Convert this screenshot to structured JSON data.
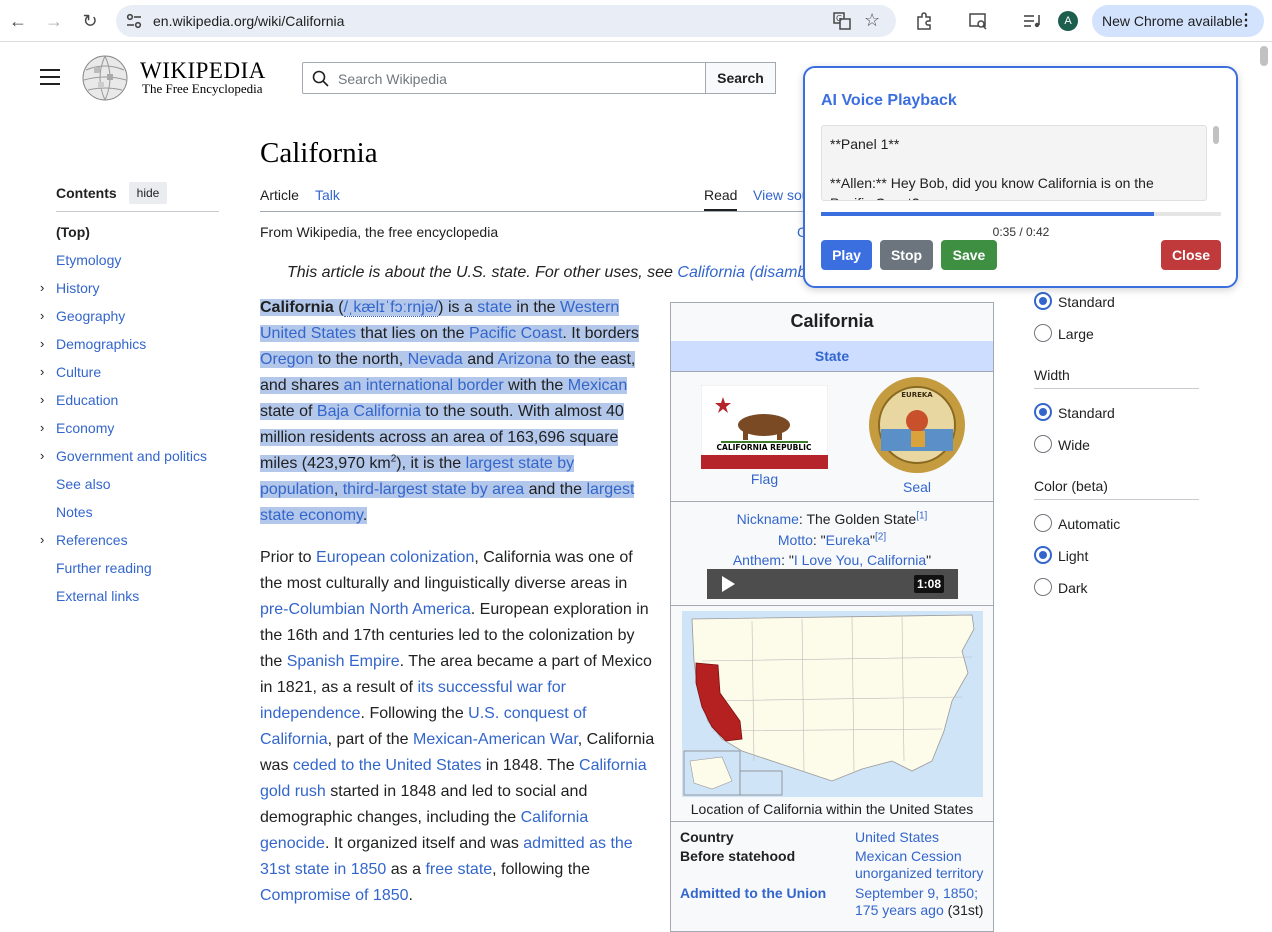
{
  "browser": {
    "url": "en.wikipedia.org/wiki/California",
    "avatar_letter": "A",
    "update_label": "New Chrome available"
  },
  "header": {
    "wordmark": "WIKIPEDIA",
    "tagline": "The Free Encyclopedia",
    "search_placeholder": "Search Wikipedia",
    "search_button": "Search"
  },
  "article": {
    "title": "California",
    "tabs": {
      "article": "Article",
      "talk": "Talk",
      "read": "Read",
      "view_source": "View source"
    },
    "from_wiki": "From Wikipedia, the free encyclopedia",
    "from_wiki_clip": "C",
    "hatnote_prefix": "This article is about the U.S. state. For other uses, see ",
    "hatnote_link": "California (disambiguation)"
  },
  "toc": {
    "heading": "Contents",
    "hide": "hide",
    "items": [
      {
        "label": "(Top)",
        "chev": ""
      },
      {
        "label": "Etymology",
        "chev": ""
      },
      {
        "label": "History",
        "chev": "›"
      },
      {
        "label": "Geography",
        "chev": "›"
      },
      {
        "label": "Demographics",
        "chev": "›"
      },
      {
        "label": "Culture",
        "chev": "›"
      },
      {
        "label": "Education",
        "chev": "›"
      },
      {
        "label": "Economy",
        "chev": "›"
      },
      {
        "label": "Government and politics",
        "chev": "›"
      },
      {
        "label": "See also",
        "chev": ""
      },
      {
        "label": "Notes",
        "chev": ""
      },
      {
        "label": "References",
        "chev": "›"
      },
      {
        "label": "Further reading",
        "chev": ""
      },
      {
        "label": "External links",
        "chev": ""
      }
    ]
  },
  "lead": {
    "bold": "California",
    "ipa_open": " (",
    "ipa": "/ˌkælɪˈfɔːrnjə/",
    "t1": ") is a ",
    "l_state": "state",
    "t2": " in the ",
    "l_wus": "Western United States",
    "t3": " that lies on the ",
    "l_pc": "Pacific Coast",
    "t4": ". It borders ",
    "l_or": "Oregon",
    "t5": " to the north, ",
    "l_nv": "Nevada",
    "t6": " and ",
    "l_az": "Arizona",
    "t7": " to the east, and shares ",
    "l_ib": "an international border",
    "t8": " with the ",
    "l_mx": "Mexican",
    "t9": " state of ",
    "l_bc": "Baja California",
    "t10": " to the south. With almost 40 million residents across an area of 163,696 square miles (423,970 km",
    "sup2": "2",
    "t11": "), it is the ",
    "l_lsp": "largest state by population",
    "t12": ", ",
    "l_tla": "third-largest state by area",
    "t13": " and the ",
    "l_lse": "largest state economy",
    "t14": "."
  },
  "para2": {
    "t1": "Prior to ",
    "l_ec": "European colonization",
    "t2": ", California was one of the most culturally and linguistically diverse areas in ",
    "l_pcna": "pre-Columbian North America",
    "t3": ". European exploration in the 16th and 17th centuries led to the colonization by the ",
    "l_se": "Spanish Empire",
    "t4": ". The area became a part of Mexico in 1821, as a result of ",
    "l_swi": "its successful war for independence",
    "t5": ". Following the ",
    "l_usc": "U.S. conquest of California",
    "t6": ", part of the ",
    "l_maw": "Mexican-American War",
    "t7": ", California was ",
    "l_ceded": "ceded to the United States",
    "t8": " in 1848. The ",
    "l_gr": "California gold rush",
    "t9": " started in 1848 and led to social and demographic changes, including the ",
    "l_gen": "California genocide",
    "t10": ". It organized itself and was ",
    "l_adm": "admitted as the 31st state in 1850",
    "t11": " as a ",
    "l_fs": "free state",
    "t12": ", following the ",
    "l_c1850": "Compromise of 1850",
    "t13": "."
  },
  "infobox": {
    "title": "California",
    "subtitle": "State",
    "flag_caption": "Flag",
    "flag_text": "CALIFORNIA REPUBLIC",
    "seal_caption": "Seal",
    "seal_text": "EUREKA",
    "nickname_label": "Nickname",
    "nickname_value": ": The Golden State",
    "nickname_ref": "[1]",
    "motto_label": "Motto",
    "motto_open": ": \"",
    "motto_value": "Eureka",
    "motto_close": "\"",
    "motto_ref": "[2]",
    "anthem_label": "Anthem",
    "anthem_open": ": \"",
    "anthem_value": "I Love You, California",
    "anthem_close": "\"",
    "audio_duration": "1:08",
    "map_caption": "Location of California within the United States",
    "rows": {
      "country_label": "Country",
      "country_value": "United States",
      "before_label": "Before statehood",
      "before_value1": "Mexican Cession",
      "before_value2": "unorganized territory",
      "admitted_label": "Admitted to the Union",
      "admitted_value1": "September 9, 1850;",
      "admitted_value2": "175 years ago",
      "admitted_suffix": " (31st)"
    }
  },
  "appearance": {
    "text_options": [
      "Standard",
      "Large"
    ],
    "width_label": "Width",
    "width_options": [
      "Standard",
      "Wide"
    ],
    "color_label": "Color (beta)",
    "color_options": [
      "Automatic",
      "Light",
      "Dark"
    ]
  },
  "ai_panel": {
    "title": "AI Voice Playback",
    "line1": "**Panel 1**",
    "line2": "**Allen:** Hey Bob, did you know California is on the Pacific Coast?",
    "progress": 0.833,
    "time": "0:35 / 0:42",
    "play": "Play",
    "stop": "Stop",
    "save": "Save",
    "close": "Close"
  },
  "colors": {
    "accent": "#3b6fe0",
    "link": "#3366cc",
    "highlight": "#b3c7ea",
    "save_green": "#3f8f43",
    "close_red": "#c0393b"
  }
}
